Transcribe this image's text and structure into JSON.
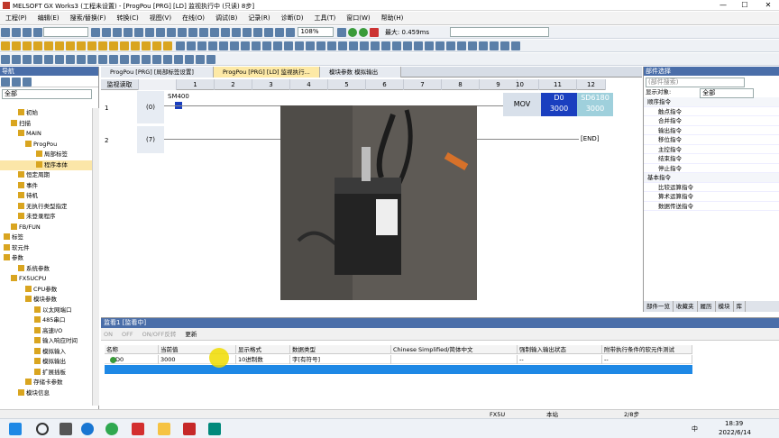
{
  "window": {
    "title": "MELSOFT GX Works3 (工程未设置) - [ProgPou [PRG] [LD] 监视执行中 (只读) 8步]"
  },
  "menu": [
    "工程(P)",
    "编辑(E)",
    "搜索/替换(F)",
    "转换(C)",
    "视图(V)",
    "在线(O)",
    "调试(B)",
    "记录(R)",
    "诊断(D)",
    "工具(T)",
    "窗口(W)",
    "帮助(H)"
  ],
  "toolbar": {
    "zoom": "108%",
    "scan_label": "最大: 0.459ms"
  },
  "nav": {
    "title": "导航",
    "filter": "全部",
    "tree": [
      "初始",
      "扫描",
      "MAIN",
      "ProgPou",
      "局部标签",
      "程序本体",
      "恒定周期",
      "事件",
      "待机",
      "无执行类型指定",
      "未登录程序",
      "FB/FUN",
      "标签",
      "软元件",
      "参数",
      "系统参数",
      "FX5UCPU",
      "CPU参数",
      "模块参数",
      "以太网端口",
      "485串口",
      "高速I/O",
      "输入响应时间",
      "模拟输入",
      "模拟输出",
      "扩展插板",
      "存储卡参数",
      "模块信息"
    ]
  },
  "tabs": [
    "ProgPou [PRG] [局部标签设置]",
    "ProgPou [PRG] [LD] 监视执行...",
    "模块参数 模拟输出"
  ],
  "ladder": {
    "read_label": "监视读取",
    "columns": [
      "1",
      "2",
      "3",
      "4",
      "5",
      "6",
      "7",
      "8",
      "9",
      "10",
      "11",
      "12"
    ],
    "rows": [
      {
        "row": "1",
        "step": "(0)",
        "contact": "SM400",
        "inst": "MOV",
        "dest": "D0",
        "dest_val": "3000",
        "src": "SD6180",
        "src_val": "3000"
      },
      {
        "row": "2",
        "step": "(7)",
        "end": "END"
      }
    ]
  },
  "parts": {
    "title": "部件选择",
    "search_placeholder": "(部件搜索)",
    "display_target_label": "显示对象:",
    "display_target": "全部",
    "items": [
      {
        "label": "顺序指令",
        "cat": true
      },
      {
        "label": "触点指令"
      },
      {
        "label": "合并指令"
      },
      {
        "label": "输出指令"
      },
      {
        "label": "移位指令"
      },
      {
        "label": "主控指令"
      },
      {
        "label": "结束指令"
      },
      {
        "label": "停止指令"
      },
      {
        "label": "基本指令",
        "cat": true
      },
      {
        "label": "比较运算指令"
      },
      {
        "label": "算术运算指令"
      },
      {
        "label": "数据传送指令"
      }
    ],
    "tabs": [
      "部件一览",
      "收藏夹",
      "履历",
      "模块",
      "库"
    ]
  },
  "monitor": {
    "title": "监看1 [监看中]",
    "toolbar": [
      "ON",
      "OFF",
      "ON/OFF反转",
      "更新"
    ],
    "headers": [
      "名称",
      "当前值",
      "显示格式",
      "数据类型",
      "Chinese Simplified/简体中文",
      "强制输入输出状态",
      "附带执行条件的软元件测试"
    ],
    "rows": [
      {
        "name": "D0",
        "value": "3000",
        "format": "10进制数",
        "type": "字[有符号]",
        "lang": "",
        "force": "--",
        "test": "--"
      }
    ]
  },
  "status": {
    "cpu": "FX5U",
    "station": "本站",
    "step": "2/8步"
  },
  "taskbar": {
    "time": "18:39",
    "date": "2022/6/14",
    "ime": "中"
  }
}
